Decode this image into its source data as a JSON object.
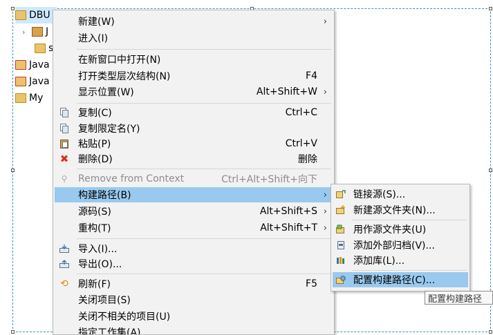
{
  "tree": {
    "items": [
      {
        "label": "DBU",
        "icon": "project-folder-icon"
      },
      {
        "label": "J",
        "icon": "library-icon"
      },
      {
        "label": "s",
        "icon": "package-icon"
      },
      {
        "label": "Java",
        "icon": "java-project-icon"
      },
      {
        "label": "Java",
        "icon": "java-project-icon"
      },
      {
        "label": "My",
        "icon": "project-folder-icon"
      }
    ]
  },
  "context_menu": {
    "items": [
      {
        "label": "新建(W)",
        "accel": "",
        "submenu": true
      },
      {
        "label": "进入(I)",
        "accel": ""
      },
      {
        "label": "在新窗口中打开(N)",
        "accel": ""
      },
      {
        "label": "打开类型层次结构(N)",
        "accel": "F4"
      },
      {
        "label": "显示位置(W)",
        "accel": "Alt+Shift+W",
        "submenu": true
      },
      {
        "label": "复制(C)",
        "accel": "Ctrl+C",
        "icon": "copy-icon"
      },
      {
        "label": "复制限定名(Y)",
        "accel": "",
        "icon": "copy-qualified-icon"
      },
      {
        "label": "粘贴(P)",
        "accel": "Ctrl+V",
        "icon": "paste-icon"
      },
      {
        "label": "删除(D)",
        "accel": "删除",
        "icon": "delete-icon"
      },
      {
        "label": "Remove from Context",
        "accel": "Ctrl+Alt+Shift+向下",
        "icon": "remove-context-icon",
        "disabled": true
      },
      {
        "label": "构建路径(B)",
        "accel": "",
        "submenu": true,
        "hover": true
      },
      {
        "label": "源码(S)",
        "accel": "Alt+Shift+S",
        "submenu": true
      },
      {
        "label": "重构(T)",
        "accel": "Alt+Shift+T",
        "submenu": true
      },
      {
        "label": "导入(I)...",
        "accel": "",
        "icon": "import-icon"
      },
      {
        "label": "导出(O)...",
        "accel": "",
        "icon": "export-icon"
      },
      {
        "label": "刷新(F)",
        "accel": "F5",
        "icon": "refresh-icon"
      },
      {
        "label": "关闭项目(S)",
        "accel": ""
      },
      {
        "label": "关闭不相关的项目(U)",
        "accel": ""
      },
      {
        "label": "指定工作集(A)...",
        "accel": ""
      }
    ]
  },
  "build_path_submenu": {
    "items": [
      {
        "label": "链接源(S)...",
        "icon": "link-source-icon"
      },
      {
        "label": "新建源文件夹(N)...",
        "icon": "new-source-folder-icon"
      },
      {
        "label": "用作源文件夹(U)",
        "icon": "use-as-source-icon"
      },
      {
        "label": "添加外部归档(V)...",
        "icon": "add-external-archive-icon"
      },
      {
        "label": "添加库(L)...",
        "icon": "add-library-icon"
      },
      {
        "label": "配置构建路径(C)...",
        "icon": "configure-build-path-icon",
        "hover": true
      }
    ]
  },
  "tooltip": {
    "text": "配置构建路径"
  },
  "colors": {
    "hover": "#99c9ef",
    "menu_bg": "#f2f2f2",
    "selection": "#cde8ff"
  }
}
